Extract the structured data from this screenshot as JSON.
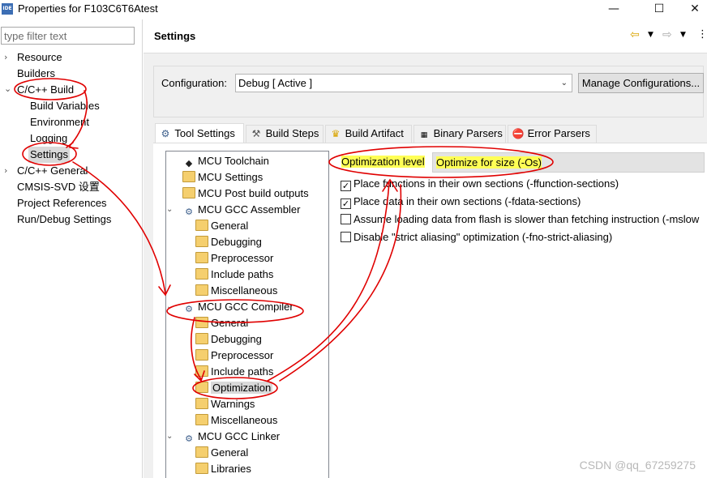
{
  "window": {
    "app_icon_text": "IDE",
    "title": "Properties for F103C6T6Atest",
    "minimize": "—",
    "maximize": "☐",
    "close": "✕"
  },
  "left": {
    "filter_placeholder": "type filter text",
    "items": [
      {
        "label": "Resource",
        "arrow": "›"
      },
      {
        "label": "Builders",
        "arrow": ""
      },
      {
        "label": "C/C++ Build",
        "arrow": "⌄"
      },
      {
        "label": "Build Variables",
        "arrow": ""
      },
      {
        "label": "Environment",
        "arrow": ""
      },
      {
        "label": "Logging",
        "arrow": ""
      },
      {
        "label": "Settings",
        "arrow": ""
      },
      {
        "label": "C/C++ General",
        "arrow": "›"
      },
      {
        "label": "CMSIS-SVD 设置",
        "arrow": ""
      },
      {
        "label": "Project References",
        "arrow": ""
      },
      {
        "label": "Run/Debug Settings",
        "arrow": ""
      }
    ]
  },
  "header": {
    "title": "Settings",
    "icons": [
      "back-arrow-icon",
      "dropdown-icon",
      "forward-arrow-icon",
      "dropdown-icon",
      "menu-icon"
    ]
  },
  "config": {
    "label": "Configuration:",
    "value": "Debug  [ Active ]",
    "manage_label": "Manage Configurations..."
  },
  "tabs": [
    {
      "label": "Tool Settings",
      "icon": "⚙"
    },
    {
      "label": "Build Steps",
      "icon": "🔨"
    },
    {
      "label": "Build Artifact",
      "icon": "🏆"
    },
    {
      "label": "Binary Parsers",
      "icon": "▦"
    },
    {
      "label": "Error Parsers",
      "icon": "⛔"
    }
  ],
  "tree": [
    {
      "label": "MCU Toolchain",
      "icon": "chip"
    },
    {
      "label": "MCU Settings",
      "icon": "folder"
    },
    {
      "label": "MCU Post build outputs",
      "icon": "folder"
    },
    {
      "label": "MCU GCC Assembler",
      "icon": "gear",
      "exp": "⌄"
    },
    {
      "label": "General",
      "icon": "folder"
    },
    {
      "label": "Debugging",
      "icon": "folder"
    },
    {
      "label": "Preprocessor",
      "icon": "folder"
    },
    {
      "label": "Include paths",
      "icon": "folder"
    },
    {
      "label": "Miscellaneous",
      "icon": "folder"
    },
    {
      "label": "MCU GCC Compiler",
      "icon": "gear",
      "exp": "⌄"
    },
    {
      "label": "General",
      "icon": "folder"
    },
    {
      "label": "Debugging",
      "icon": "folder"
    },
    {
      "label": "Preprocessor",
      "icon": "folder"
    },
    {
      "label": "Include paths",
      "icon": "folder"
    },
    {
      "label": "Optimization",
      "icon": "folder"
    },
    {
      "label": "Warnings",
      "icon": "folder"
    },
    {
      "label": "Miscellaneous",
      "icon": "folder"
    },
    {
      "label": "MCU GCC Linker",
      "icon": "gear",
      "exp": "⌄"
    },
    {
      "label": "General",
      "icon": "folder"
    },
    {
      "label": "Libraries",
      "icon": "folder"
    }
  ],
  "options": {
    "level_label": "Optimization level",
    "level_value": "Optimize for size (-Os)",
    "checks": [
      {
        "label": "Place functions in their own sections (-ffunction-sections)",
        "checked": true
      },
      {
        "label": "Place data in their own sections (-fdata-sections)",
        "checked": true
      },
      {
        "label": "Assume loading data from flash is slower than fetching instruction (-mslow",
        "checked": false
      },
      {
        "label": "Disable \"strict aliasing\" optimization (-fno-strict-aliasing)",
        "checked": false
      }
    ]
  },
  "watermark": "CSDN @qq_67259275",
  "colors": {
    "highlight": "#ffff55",
    "annotation": "#e00000",
    "selection": "#d9d9d9"
  }
}
